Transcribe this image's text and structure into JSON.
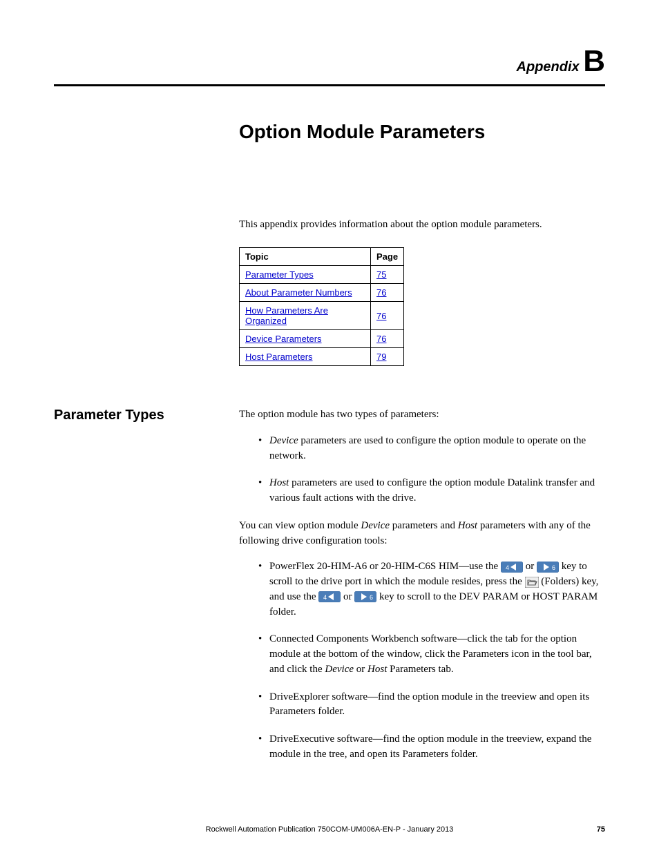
{
  "header": {
    "appendix_prefix": "Appendix ",
    "appendix_letter": "B"
  },
  "title": "Option Module Parameters",
  "intro": "This appendix provides information about the option module parameters.",
  "toc": {
    "head_topic": "Topic",
    "head_page": "Page",
    "rows": [
      {
        "topic": "Parameter Types",
        "page": "75"
      },
      {
        "topic": "About Parameter Numbers",
        "page": "76"
      },
      {
        "topic": "How Parameters Are Organized",
        "page": "76"
      },
      {
        "topic": "Device Parameters",
        "page": "76"
      },
      {
        "topic": "Host Parameters",
        "page": "79"
      }
    ]
  },
  "section": {
    "heading": "Parameter Types",
    "p1": "The option module has two types of parameters:",
    "bullets1": {
      "b1_em": "Device",
      "b1_rest": " parameters are used to configure the option module to operate on the network.",
      "b2_em": "Host",
      "b2_rest": " parameters are used to configure the option module Datalink transfer and various fault actions with the drive."
    },
    "p2_a": "You can view option module ",
    "p2_em1": "Device",
    "p2_b": " parameters and ",
    "p2_em2": "Host",
    "p2_c": " parameters with any of the following drive configuration tools:",
    "bullets2": {
      "b1_a": "PowerFlex 20-HIM-A6 or 20-HIM-C6S HIM—use the ",
      "b1_b": " or ",
      "b1_c": " key to scroll to the drive port in which the module resides, press the ",
      "b1_d": " (Folders) key, and use the ",
      "b1_e": " or ",
      "b1_f": " key to scroll to the DEV PARAM or HOST PARAM folder.",
      "b2_a": "Connected Components Workbench software—click the tab for the option module at the bottom of the window, click the Parameters icon in the tool bar, and click the ",
      "b2_em1": "Device",
      "b2_b": " or ",
      "b2_em2": "Host",
      "b2_c": " Parameters tab.",
      "b3": "DriveExplorer software—find the option module in the treeview and open its Parameters folder.",
      "b4": "DriveExecutive software—find the option module in the treeview, expand the module in the tree, and open its Parameters folder."
    }
  },
  "footer": {
    "text": "Rockwell Automation Publication 750COM-UM006A-EN-P - January 2013",
    "page": "75"
  }
}
